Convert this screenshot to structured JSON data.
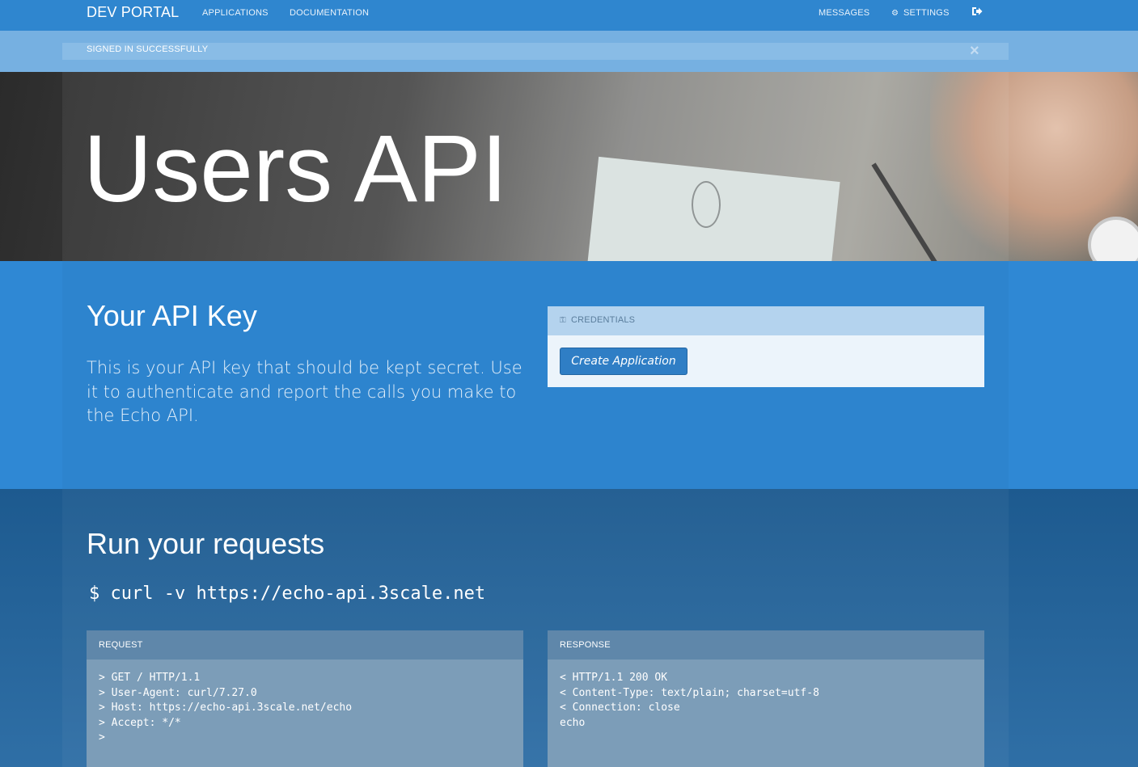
{
  "nav": {
    "brand": "DEV PORTAL",
    "applications": "APPLICATIONS",
    "documentation": "DOCUMENTATION",
    "messages": "MESSAGES",
    "settings": "SETTINGS",
    "settings_icon": "gears-icon",
    "signout_icon": "sign-out-icon"
  },
  "flash": {
    "message": "SIGNED IN SUCCESSFULLY",
    "close": "×"
  },
  "hero": {
    "title": "Users API"
  },
  "api_key": {
    "title": "Your API Key",
    "description": "This is your API key that should be kept secret. Use it to authenticate and report the calls you make to the Echo API.",
    "panel_title": "CREDENTIALS",
    "panel_icon": "key-icon",
    "create_button": "Create Application"
  },
  "run": {
    "title": "Run your requests",
    "command": "$ curl -v https://echo-api.3scale.net",
    "request_title": "REQUEST",
    "request_body": "> GET / HTTP/1.1\n> User-Agent: curl/7.27.0\n> Host: https://echo-api.3scale.net/echo\n> Accept: */*\n>",
    "response_title": "RESPONSE",
    "response_body": "< HTTP/1.1 200 OK\n< Content-Type: text/plain; charset=utf-8\n< Connection: close\necho"
  },
  "colors": {
    "navbar": "#2f86cf",
    "flash": "#76b0e1",
    "key_section": "#2f88d4",
    "run_section": "#1d5a8f",
    "button": "#2f7ec5"
  }
}
